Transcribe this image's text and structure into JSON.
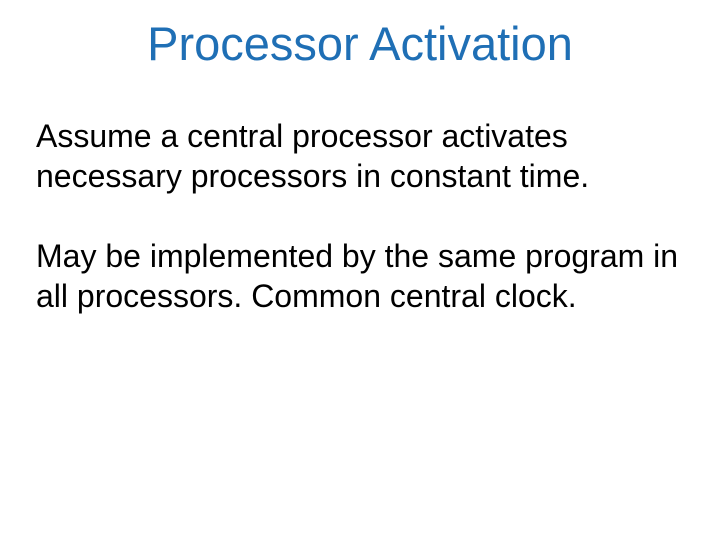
{
  "title": "Processor Activation",
  "paragraphs": [
    "Assume a central processor activates necessary processors in constant time.",
    "May be implemented by the same program in all processors. Common central clock."
  ]
}
